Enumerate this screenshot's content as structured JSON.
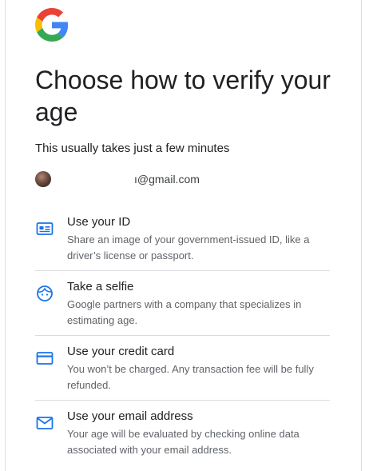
{
  "brand": {
    "logo_icon": "google-g-logo-icon",
    "colors": {
      "blue": "#4285F4",
      "red": "#EA4335",
      "yellow": "#FBBC05",
      "green": "#34A853",
      "icon_blue": "#1a73e8"
    }
  },
  "header": {
    "title": "Choose how to verify your age",
    "subtitle": "This usually takes just a few minutes"
  },
  "account": {
    "email": "ı@gmail.com",
    "avatar_icon": "user-avatar"
  },
  "options": [
    {
      "icon": "id-card-icon",
      "title": "Use your ID",
      "description": "Share an image of your government-issued ID, like a driver’s license or passport."
    },
    {
      "icon": "face-icon",
      "title": "Take a selfie",
      "description": "Google partners with a company that specializes in estimating age."
    },
    {
      "icon": "credit-card-icon",
      "title": "Use your credit card",
      "description": "You won’t be charged. Any transaction fee will be fully refunded."
    },
    {
      "icon": "mail-icon",
      "title": "Use your email address",
      "description": "Your age will be evaluated by checking online data associated with your email address."
    }
  ]
}
